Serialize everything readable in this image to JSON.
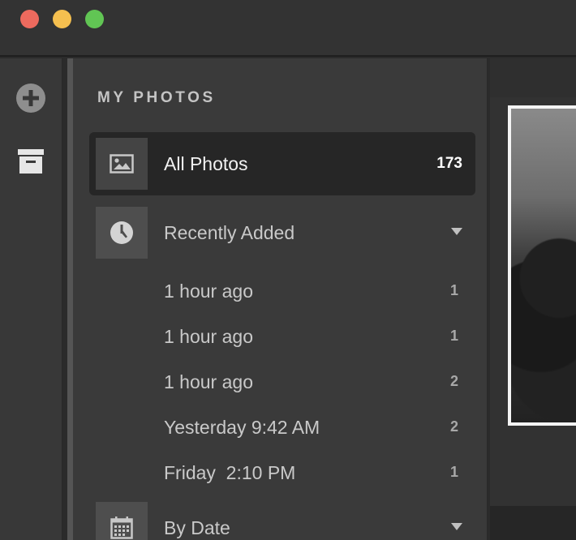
{
  "window": {
    "buttons": [
      "close",
      "minimize",
      "zoom"
    ]
  },
  "rail": {
    "items": [
      {
        "icon": "plus-circle-icon"
      },
      {
        "icon": "archive-box-icon"
      }
    ]
  },
  "sidebar": {
    "section_title": "MY PHOTOS",
    "all_photos": {
      "label": "All Photos",
      "count": "173",
      "icon": "image-icon"
    },
    "recently_added": {
      "label": "Recently Added",
      "icon": "clock-icon",
      "expanded": true
    },
    "recent_items": [
      {
        "label": "1 hour ago",
        "count": "1"
      },
      {
        "label": "1 hour ago",
        "count": "1"
      },
      {
        "label": "1 hour ago",
        "count": "2"
      },
      {
        "label": "Yesterday 9:42 AM",
        "count": "2"
      },
      {
        "label": "Friday  2:10 PM",
        "count": "1"
      }
    ],
    "by_date": {
      "label": "By Date",
      "icon": "calendar-icon"
    }
  },
  "colors": {
    "close": "#ed6a5e",
    "minimize": "#f5bf4f",
    "zoom": "#61c554",
    "selected_row": "#262626"
  }
}
